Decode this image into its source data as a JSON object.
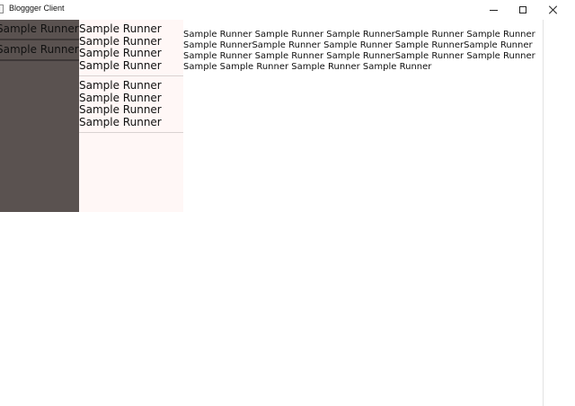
{
  "window": {
    "title": "Bloggger Client"
  },
  "sidebar": {
    "items": [
      {
        "label": "Sample Runner"
      },
      {
        "label": "Sample Runner"
      }
    ]
  },
  "middle": {
    "groups": [
      {
        "lines": [
          "Sample Runner",
          "Sample Runner",
          "Sample Runner",
          "Sample Runner"
        ]
      },
      {
        "lines": [
          "Sample Runner",
          "Sample Runner",
          "Sample Runner",
          "Sample Runner"
        ]
      }
    ]
  },
  "content": {
    "text": "Sample Runner Sample Runner Sample RunnerSample Runner Sample Runner Sample RunnerSample Runner Sample Runner Sample RunnerSample Runner Sample Runner Sample Runner Sample RunnerSample Runner Sample Runner Sample Sample Runner Sample Runner Sample Runner"
  },
  "colors": {
    "sidebar_bg": "#5a5250",
    "middle_bg": "#fff7f6"
  }
}
